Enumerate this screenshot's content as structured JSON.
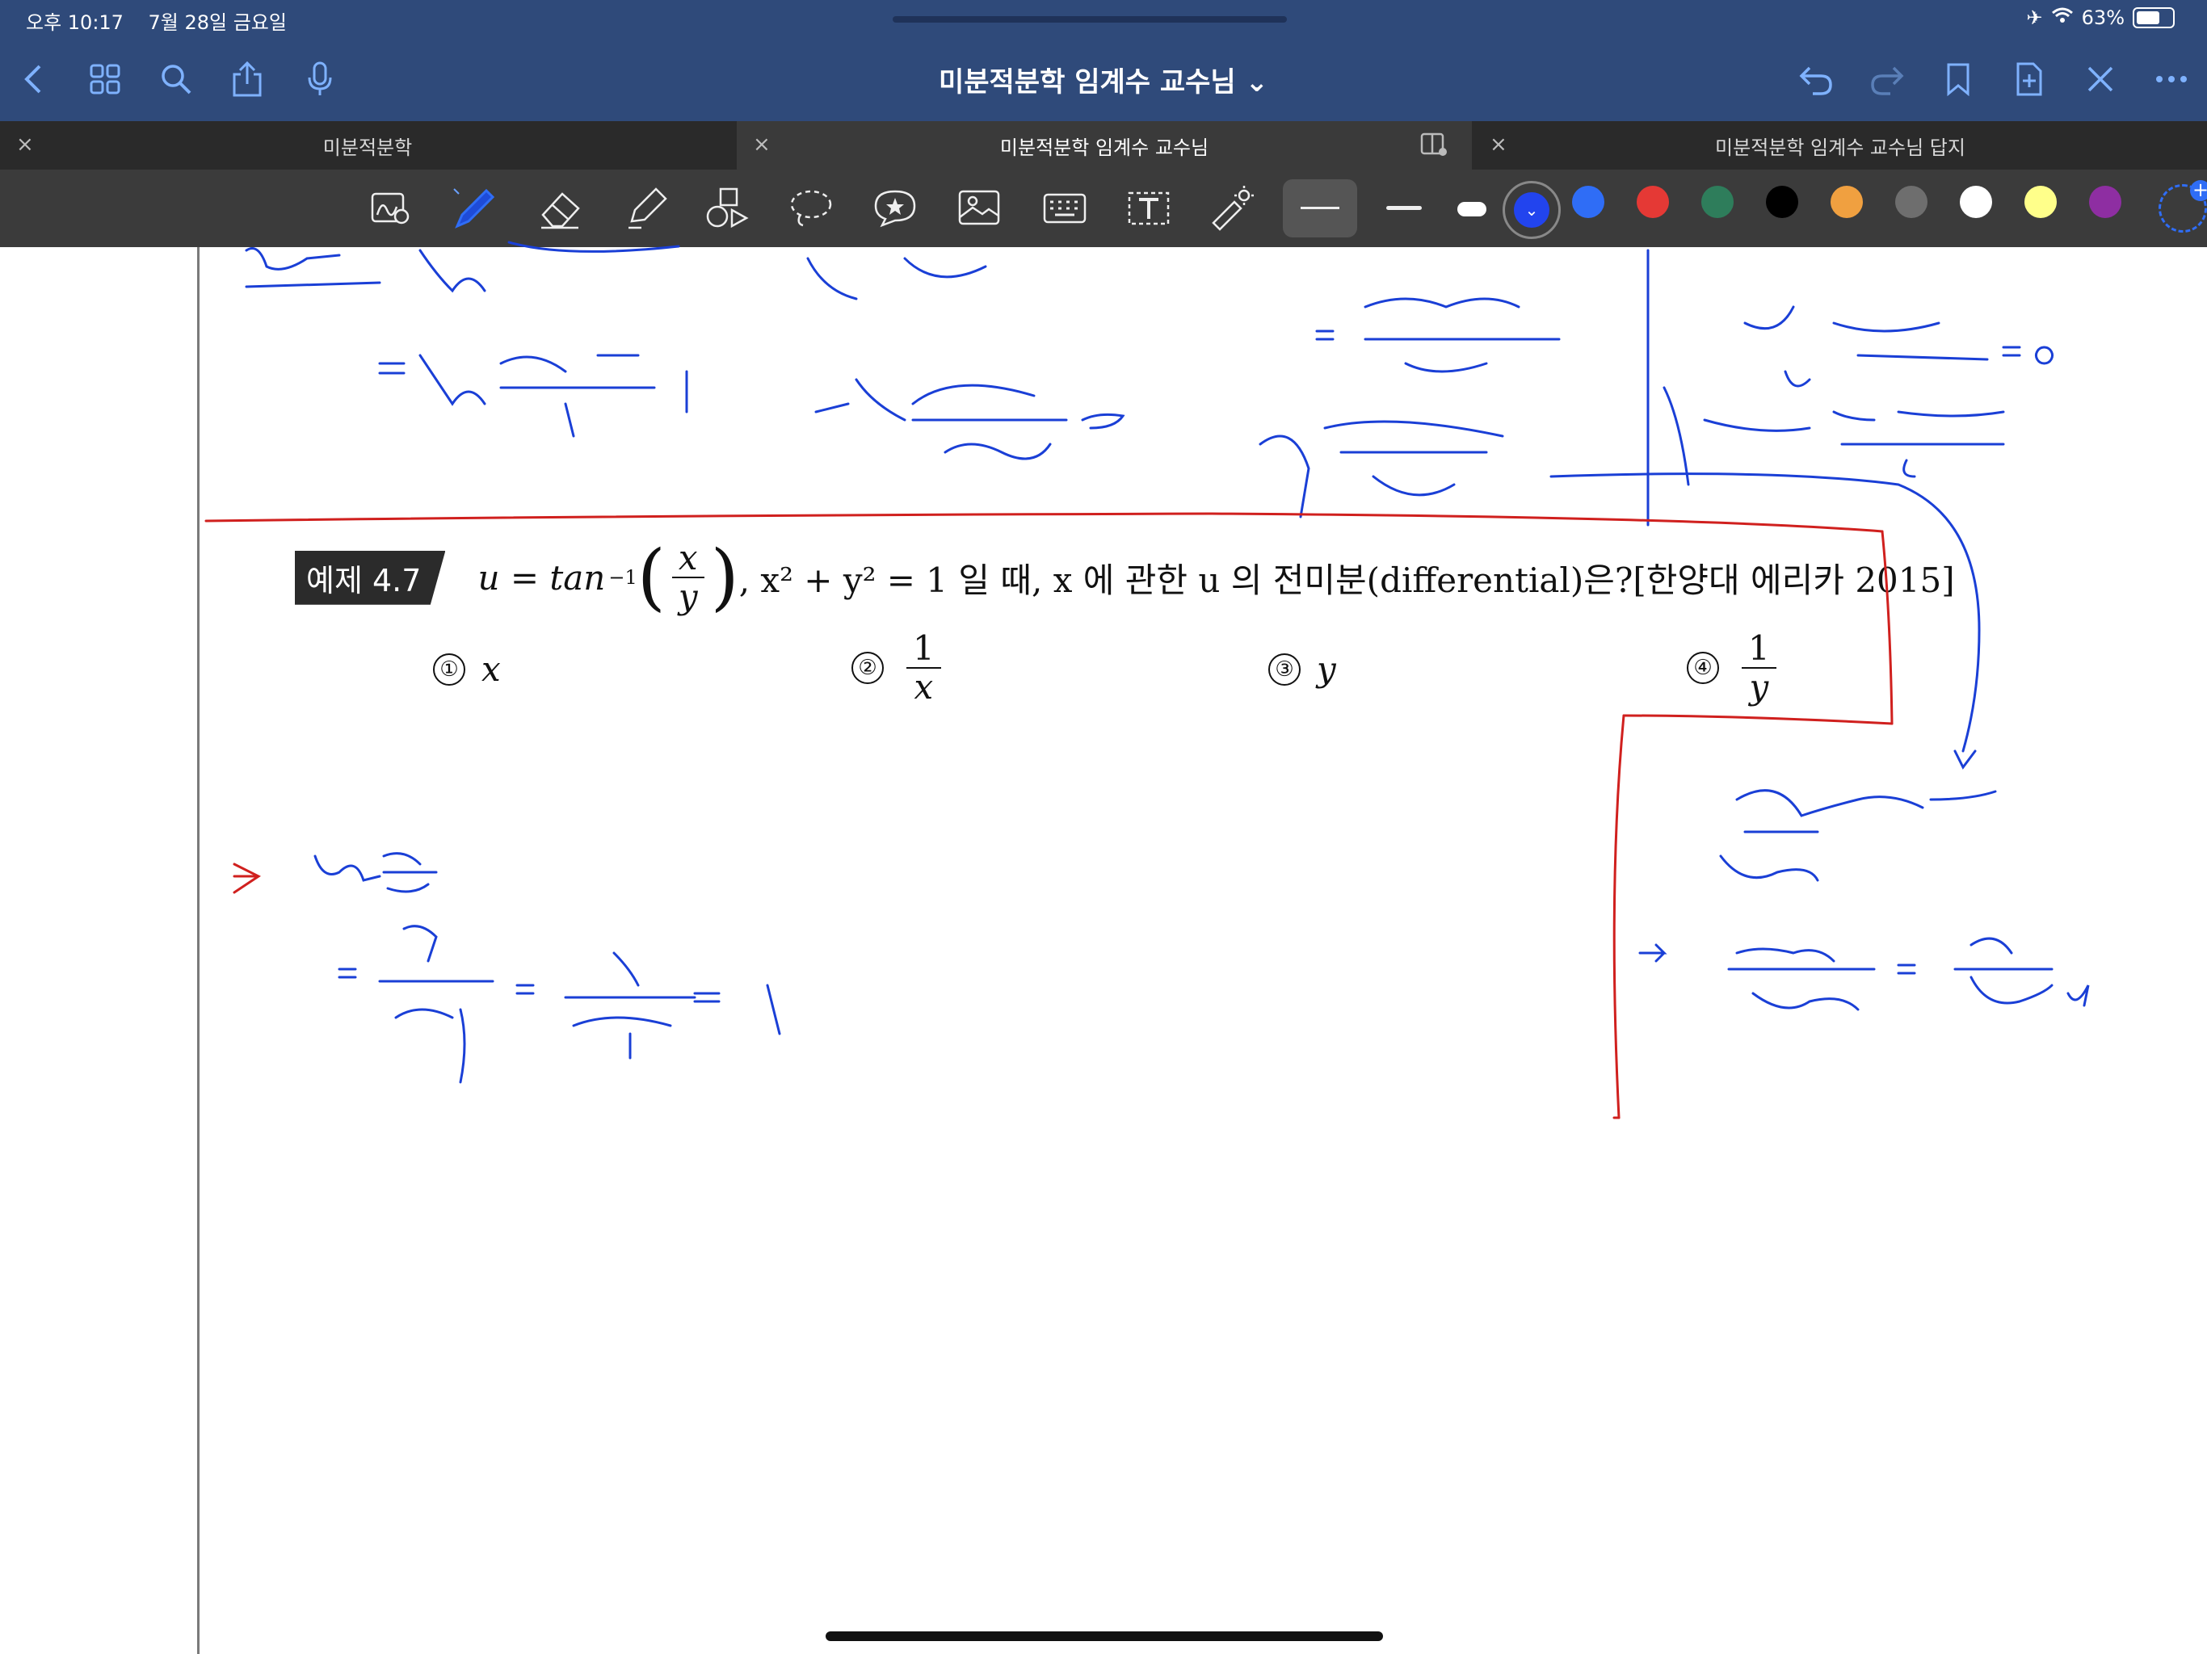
{
  "status": {
    "time": "오후 10:17",
    "date": "7월 28일 금요일",
    "battery": "63%"
  },
  "nav": {
    "title": "미분적분학 임계수 교수님 ⌄"
  },
  "tabs": [
    {
      "label": "미분적분학",
      "active": false
    },
    {
      "label": "미분적분학 임계수 교수님",
      "active": true
    },
    {
      "label": "미분적분학 임계수 교수님 답지",
      "active": false
    }
  ],
  "toolbar": {
    "colors": [
      "#2f6df6",
      "#e53935",
      "#2e7d5b",
      "#000000",
      "#f0a040",
      "#6e6e6e",
      "#ffffff",
      "#ffff8a",
      "#8e2ea2"
    ],
    "selected_color": "#2244ee"
  },
  "problem": {
    "badge": "예제 4.7",
    "text_u": "u = tan",
    "sup": "−1",
    "frac_num": "x",
    "frac_den": "y",
    "text_mid": ",  x² + y² = 1 일 때, x 에 관한 u 의 전미분(differential)은?[한양대 에리카 2015]"
  },
  "choices": [
    {
      "num": "①",
      "value": "x"
    },
    {
      "num": "②",
      "num_val": "1",
      "den_val": "x"
    },
    {
      "num": "③",
      "value": "y"
    },
    {
      "num": "④",
      "num_val": "1",
      "den_val": "y"
    }
  ]
}
